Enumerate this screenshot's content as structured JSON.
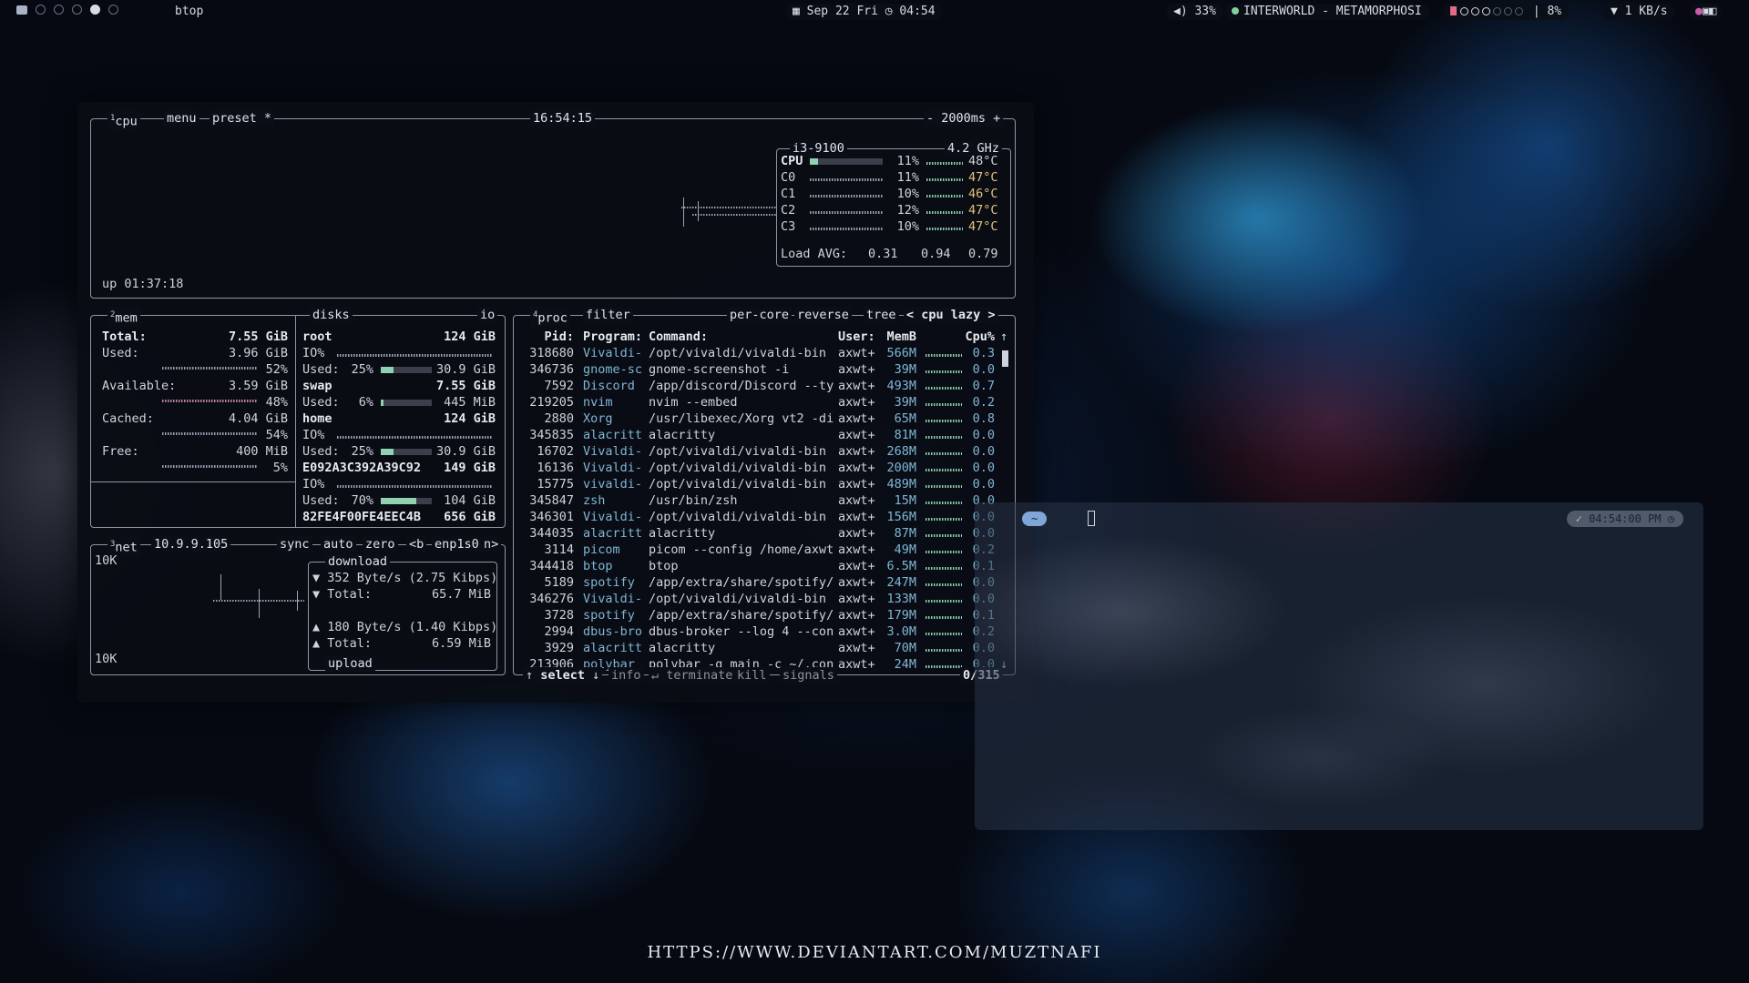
{
  "topbar": {
    "window_title": "btop",
    "datetime": "Sep 22 Fri",
    "time": "04:54",
    "volume": "33%",
    "music": "INTERWORLD - METAMORPHOSI",
    "cpu_pct": "8%",
    "net_speed": "1 KB/s"
  },
  "cpu": {
    "tab_label": "cpu",
    "tab_num": "1",
    "menu": "menu",
    "preset": "preset *",
    "clock": "16:54:15",
    "interval": "- 2000ms +",
    "uptime": "up 01:37:18",
    "model": "i3-9100",
    "freq": "4.2 GHz",
    "cores": [
      {
        "name": "CPU",
        "pct": "11%",
        "temp": "48°C",
        "level": 0.11
      },
      {
        "name": "C0",
        "pct": "11%",
        "temp": "47°C",
        "level": 0.11
      },
      {
        "name": "C1",
        "pct": "10%",
        "temp": "46°C",
        "level": 0.1
      },
      {
        "name": "C2",
        "pct": "12%",
        "temp": "47°C",
        "level": 0.12
      },
      {
        "name": "C3",
        "pct": "10%",
        "temp": "47°C",
        "level": 0.1
      }
    ],
    "load_label": "Load AVG:",
    "load": [
      "0.31",
      "0.94",
      "0.79"
    ]
  },
  "mem": {
    "tab_num": "2",
    "tab_label": "mem",
    "disks_label": "disks",
    "io_label": "io",
    "total_label": "Total:",
    "total": "7.55 GiB",
    "used_label": "Used:",
    "used": "3.96 GiB",
    "used_pct": "52%",
    "used_level": 0.52,
    "avail_label": "Available:",
    "avail": "3.59 GiB",
    "avail_pct": "48%",
    "avail_level": 0.48,
    "cached_label": "Cached:",
    "cached": "4.04 GiB",
    "cached_pct": "54%",
    "cached_level": 0.54,
    "free_label": "Free:",
    "free": "400 MiB",
    "free_pct": "5%",
    "free_level": 0.05
  },
  "disks": [
    {
      "name": "root",
      "size": "124 GiB",
      "io": "IO%",
      "used_label": "Used:",
      "used_pct": "25%",
      "used_level": 0.25,
      "used": "30.9 GiB"
    },
    {
      "name": "swap",
      "size": "7.55 GiB",
      "used_label": "Used:",
      "used_pct": "6%",
      "used_level": 0.06,
      "used": "445 MiB"
    },
    {
      "name": "home",
      "size": "124 GiB",
      "io": "IO%",
      "used_label": "Used:",
      "used_pct": "25%",
      "used_level": 0.25,
      "used": "30.9 GiB"
    },
    {
      "name": "E092A3C392A39C92",
      "size": "149 GiB",
      "io": "IO%",
      "used_label": "Used:",
      "used_pct": "70%",
      "used_level": 0.7,
      "used": "104 GiB"
    },
    {
      "name": "82FE4F00FE4EEC4B",
      "size": "656 GiB"
    }
  ],
  "net": {
    "tab_num": "3",
    "tab_label": "net",
    "ip": "10.9.9.105",
    "sync": "sync",
    "auto": "auto",
    "zero": "zero",
    "iface_prev": "<b",
    "iface": "enp1s0",
    "iface_next": "n>",
    "scale_top": "10K",
    "scale_bottom": "10K",
    "download_label": "download",
    "down_rate": "352 Byte/s (2.75 Kibps)",
    "down_total_label": "Total:",
    "down_total": "65.7 MiB",
    "up_rate": "180 Byte/s (1.40 Kibps)",
    "up_total_label": "Total:",
    "up_total": "6.59 MiB",
    "upload_label": "upload"
  },
  "proc": {
    "tab_num": "4",
    "tab_label": "proc",
    "filter": "filter",
    "per_core": "per-core",
    "reverse": "reverse",
    "tree": "tree",
    "sort": "< cpu lazy >",
    "headers": {
      "pid": "Pid:",
      "program": "Program:",
      "command": "Command:",
      "user": "User:",
      "mem": "MemB",
      "cpu": "Cpu%"
    },
    "rows": [
      {
        "pid": "318680",
        "program": "Vivaldi-",
        "command": "/opt/vivaldi/vivaldi-bin",
        "user": "axwt+",
        "mem": "566M",
        "cpu": "0.3"
      },
      {
        "pid": "346736",
        "program": "gnome-sc",
        "command": "gnome-screenshot -i",
        "user": "axwt+",
        "mem": "39M",
        "cpu": "0.0"
      },
      {
        "pid": "7592",
        "program": "Discord",
        "command": "/app/discord/Discord --ty",
        "user": "axwt+",
        "mem": "493M",
        "cpu": "0.7"
      },
      {
        "pid": "219205",
        "program": "nvim",
        "command": "nvim --embed",
        "user": "axwt+",
        "mem": "39M",
        "cpu": "0.2"
      },
      {
        "pid": "2880",
        "program": "Xorg",
        "command": "/usr/libexec/Xorg vt2 -di",
        "user": "axwt+",
        "mem": "65M",
        "cpu": "0.8"
      },
      {
        "pid": "345835",
        "program": "alacritt",
        "command": "alacritty",
        "user": "axwt+",
        "mem": "81M",
        "cpu": "0.0"
      },
      {
        "pid": "16702",
        "program": "Vivaldi-",
        "command": "/opt/vivaldi/vivaldi-bin",
        "user": "axwt+",
        "mem": "268M",
        "cpu": "0.0"
      },
      {
        "pid": "16136",
        "program": "Vivaldi-",
        "command": "/opt/vivaldi/vivaldi-bin",
        "user": "axwt+",
        "mem": "200M",
        "cpu": "0.0"
      },
      {
        "pid": "15775",
        "program": "vivaldi-",
        "command": "/opt/vivaldi/vivaldi-bin",
        "user": "axwt+",
        "mem": "489M",
        "cpu": "0.0"
      },
      {
        "pid": "345847",
        "program": "zsh",
        "command": "/usr/bin/zsh",
        "user": "axwt+",
        "mem": "15M",
        "cpu": "0.0"
      },
      {
        "pid": "346301",
        "program": "Vivaldi-",
        "command": "/opt/vivaldi/vivaldi-bin",
        "user": "axwt+",
        "mem": "156M",
        "cpu": "0.0"
      },
      {
        "pid": "344035",
        "program": "alacritt",
        "command": "alacritty",
        "user": "axwt+",
        "mem": "87M",
        "cpu": "0.0"
      },
      {
        "pid": "3114",
        "program": "picom",
        "command": "picom --config /home/axwt",
        "user": "axwt+",
        "mem": "49M",
        "cpu": "0.2"
      },
      {
        "pid": "344418",
        "program": "btop",
        "command": "btop",
        "user": "axwt+",
        "mem": "6.5M",
        "cpu": "0.1"
      },
      {
        "pid": "5189",
        "program": "spotify",
        "command": "/app/extra/share/spotify/",
        "user": "axwt+",
        "mem": "247M",
        "cpu": "0.0"
      },
      {
        "pid": "346276",
        "program": "Vivaldi-",
        "command": "/opt/vivaldi/vivaldi-bin",
        "user": "axwt+",
        "mem": "133M",
        "cpu": "0.0"
      },
      {
        "pid": "3728",
        "program": "spotify",
        "command": "/app/extra/share/spotify/",
        "user": "axwt+",
        "mem": "179M",
        "cpu": "0.1"
      },
      {
        "pid": "2994",
        "program": "dbus-bro",
        "command": "dbus-broker --log 4 --con",
        "user": "axwt+",
        "mem": "3.0M",
        "cpu": "0.2"
      },
      {
        "pid": "3929",
        "program": "alacritt",
        "command": "alacritty",
        "user": "axwt+",
        "mem": "70M",
        "cpu": "0.0"
      },
      {
        "pid": "213906",
        "program": "polybar",
        "command": "polybar -q main -c ~/.con",
        "user": "axwt+",
        "mem": "24M",
        "cpu": "0.0"
      }
    ],
    "footer": {
      "select": "select",
      "info": "info",
      "terminate": "terminate",
      "kill": "kill",
      "signals": "signals",
      "count": "0/315"
    }
  },
  "terminal2": {
    "prompt": "~",
    "clock": "04:54:00 PM"
  },
  "watermark": "HTTPS://WWW.DEVIANTART.COM/MUZTNAFI"
}
